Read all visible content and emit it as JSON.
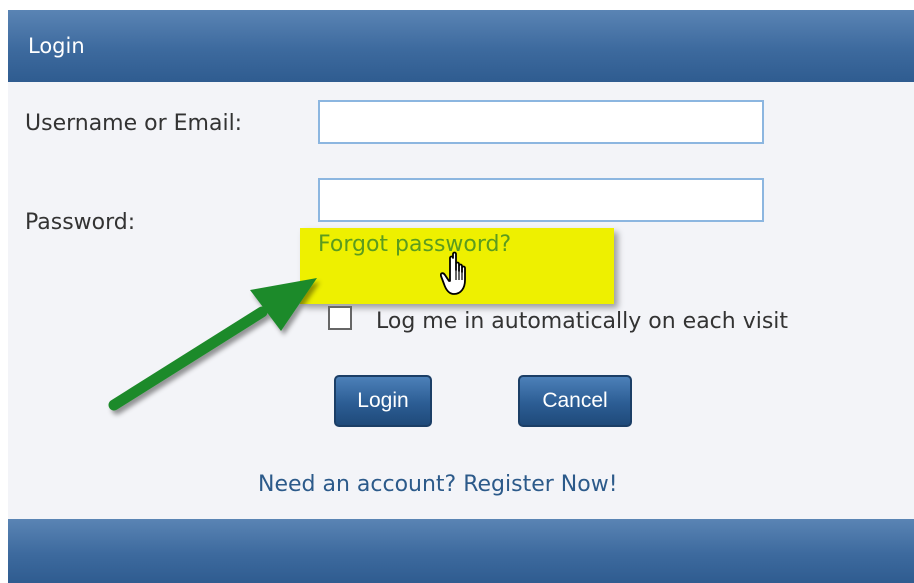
{
  "header": {
    "title": "Login"
  },
  "form": {
    "username_label": "Username or Email:",
    "username_value": "",
    "password_label": "Password:",
    "password_value": "",
    "forgot_link": "Forgot password?",
    "remember_label": "Log me in automatically on each visit",
    "remember_checked": false,
    "login_button": "Login",
    "cancel_button": "Cancel",
    "register_link": "Need an account? Register Now!"
  },
  "annotations": {
    "highlight_color": "#eef000",
    "arrow_color": "#1f8a2a",
    "cursor_icon": "hand-pointer-icon"
  },
  "colors": {
    "header_bg": "#3d6a9e",
    "link_green": "#5b9c1e",
    "link_blue": "#2c5a8a",
    "button_bg": "#2c5d94"
  }
}
